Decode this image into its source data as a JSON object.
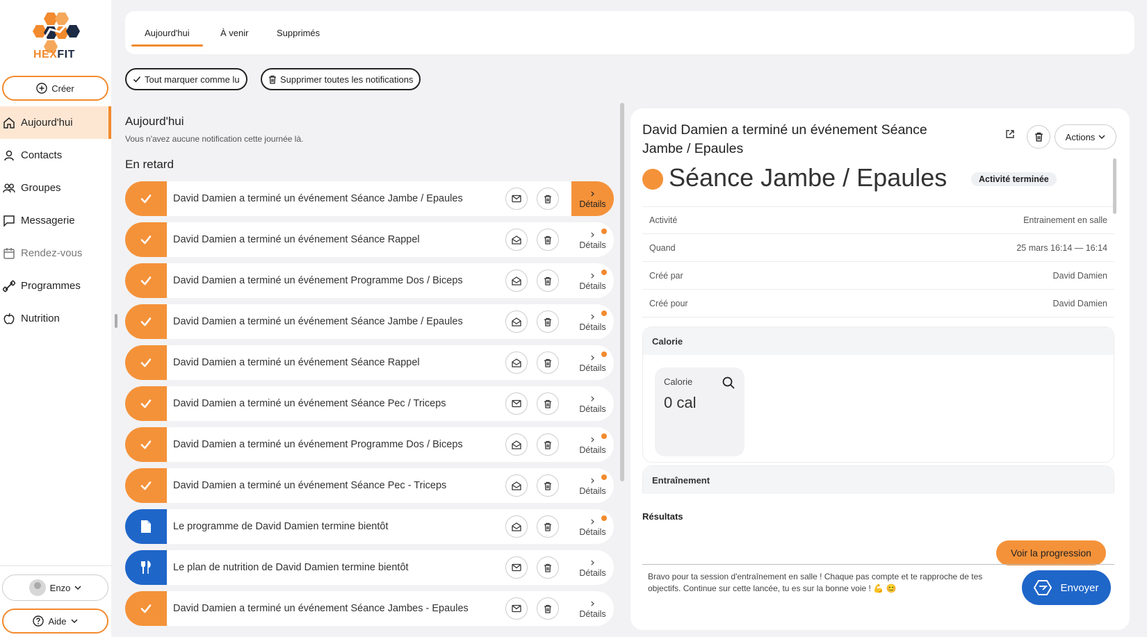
{
  "brand": {
    "name_part1": "HEX",
    "name_part2": "FIT",
    "color_primary": "#f28a2e",
    "color_secondary": "#1f66c9"
  },
  "sidebar": {
    "create_label": "Créer",
    "items": [
      {
        "label": "Aujourd'hui",
        "icon": "home-icon",
        "active": true
      },
      {
        "label": "Contacts",
        "icon": "user-icon"
      },
      {
        "label": "Groupes",
        "icon": "users-icon"
      },
      {
        "label": "Messagerie",
        "icon": "message-icon"
      },
      {
        "label": "Rendez-vous",
        "icon": "calendar-icon",
        "muted": true
      },
      {
        "label": "Programmes",
        "icon": "dumbbell-icon"
      },
      {
        "label": "Nutrition",
        "icon": "apple-icon"
      }
    ],
    "user_label": "Enzo",
    "help_label": "Aide"
  },
  "tabs": [
    {
      "label": "Aujourd'hui",
      "active": true
    },
    {
      "label": "À venir"
    },
    {
      "label": "Supprimés"
    }
  ],
  "actions": {
    "mark_all_read": "Tout marquer comme lu",
    "delete_all": "Supprimer toutes les notifications"
  },
  "today": {
    "title": "Aujourd'hui",
    "empty": "Vous n'avez aucune notification cette journée là."
  },
  "overdue": {
    "title": "En retard",
    "details_label": "Détails",
    "items": [
      {
        "text": "David Damien a terminé un événement Séance Jambe / Epaules",
        "type": "check",
        "color": "orange",
        "mail": "closed",
        "dot": false,
        "highlight": true
      },
      {
        "text": "David Damien a terminé un événement Séance Rappel",
        "type": "check",
        "color": "orange",
        "mail": "open",
        "dot": true
      },
      {
        "text": "David Damien a terminé un événement Programme Dos / Biceps",
        "type": "check",
        "color": "orange",
        "mail": "open",
        "dot": true
      },
      {
        "text": "David Damien a terminé un événement Séance Jambe / Epaules",
        "type": "check",
        "color": "orange",
        "mail": "open",
        "dot": true
      },
      {
        "text": "David Damien a terminé un événement Séance Rappel",
        "type": "check",
        "color": "orange",
        "mail": "open",
        "dot": true
      },
      {
        "text": "David Damien a terminé un événement Séance Pec / Triceps",
        "type": "check",
        "color": "orange",
        "mail": "closed",
        "dot": false
      },
      {
        "text": "David Damien a terminé un événement Programme Dos / Biceps",
        "type": "check",
        "color": "orange",
        "mail": "open",
        "dot": true
      },
      {
        "text": "David Damien a terminé un événement Séance Pec - Triceps",
        "type": "check",
        "color": "orange",
        "mail": "open",
        "dot": true
      },
      {
        "text": "Le programme de David Damien termine bientôt",
        "type": "document",
        "color": "blue",
        "mail": "open",
        "dot": true
      },
      {
        "text": "Le plan de nutrition de David Damien termine bientôt",
        "type": "cutlery",
        "color": "blue",
        "mail": "closed",
        "dot": false
      },
      {
        "text": "David Damien a terminé un événement Séance Jambes - Epaules",
        "type": "check",
        "color": "orange",
        "mail": "closed",
        "dot": false
      }
    ]
  },
  "detail": {
    "title": "David Damien a terminé un événement Séance Jambe / Epaules",
    "actions_label": "Actions",
    "event_title": "Séance Jambe / Epaules",
    "status": "Activité terminée",
    "info": [
      {
        "label": "Activité",
        "value": "Entrainement en salle"
      },
      {
        "label": "Quand",
        "value": "25 mars 16:14 — 16:14"
      },
      {
        "label": "Créé par",
        "value": "David Damien"
      },
      {
        "label": "Créé pour",
        "value": "David Damien"
      }
    ],
    "calorie_section": "Calorie",
    "calorie_label": "Calorie",
    "calorie_value": "0 cal",
    "training_section": "Entraînement",
    "results_label": "Résultats",
    "progress_button": "Voir la progression",
    "message": "Bravo pour ta session d'entraînement en salle ! Chaque pas compte et te rapproche de tes objectifs. Continue sur cette lancée, tu es sur la bonne voie ! 💪 😊",
    "send_label": "Envoyer"
  }
}
